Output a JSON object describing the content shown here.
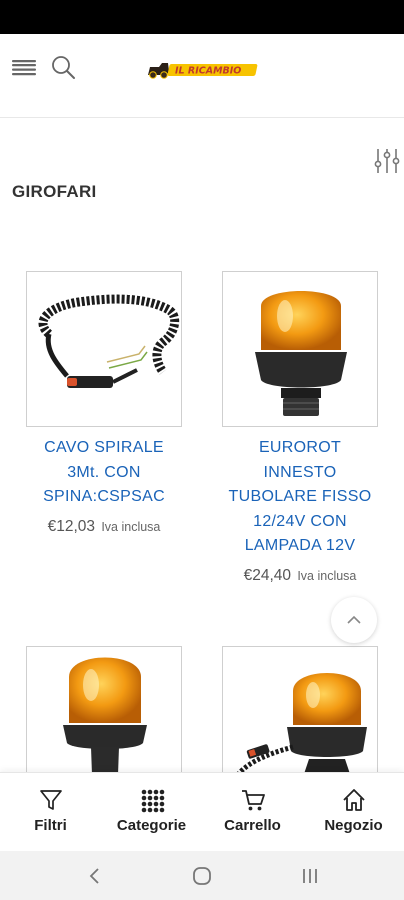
{
  "header": {
    "menu_icon": "hamburger-menu-icon",
    "search_icon": "search-icon",
    "logo_text": "IL RICAMBIO"
  },
  "page": {
    "title": "GIROFARI",
    "filter_icon": "sliders-icon"
  },
  "products": [
    {
      "name_lines": [
        "CAVO SPIRALE",
        "3Mt. CON",
        "SPINA:CSPSAC"
      ],
      "price": "€12,03",
      "vat_label": "Iva inclusa",
      "image": "coiled-cable-with-plug"
    },
    {
      "name_lines": [
        "EUROROT",
        "INNESTO",
        "TUBOLARE FISSO",
        "12/24V CON",
        "LAMPADA 12V"
      ],
      "price": "€24,40",
      "vat_label": "Iva inclusa",
      "image": "amber-beacon-tube-mount"
    },
    {
      "name_lines": [],
      "price": "",
      "vat_label": "",
      "image": "amber-beacon-flexible-pole"
    },
    {
      "name_lines": [],
      "price": "",
      "vat_label": "",
      "image": "amber-beacon-magnetic-with-cable"
    }
  ],
  "scroll_top_icon": "chevron-up-icon",
  "bottom_nav": [
    {
      "label": "Filtri",
      "icon": "funnel-icon"
    },
    {
      "label": "Categorie",
      "icon": "grid-dots-icon"
    },
    {
      "label": "Carrello",
      "icon": "cart-icon"
    },
    {
      "label": "Negozio",
      "icon": "home-icon"
    }
  ],
  "system_nav": [
    "back-icon",
    "home-circle-icon",
    "recents-icon"
  ],
  "colors": {
    "product_link": "#1a63b8",
    "beacon_amber": "#f39a12",
    "logo_yellow": "#f7c300"
  }
}
